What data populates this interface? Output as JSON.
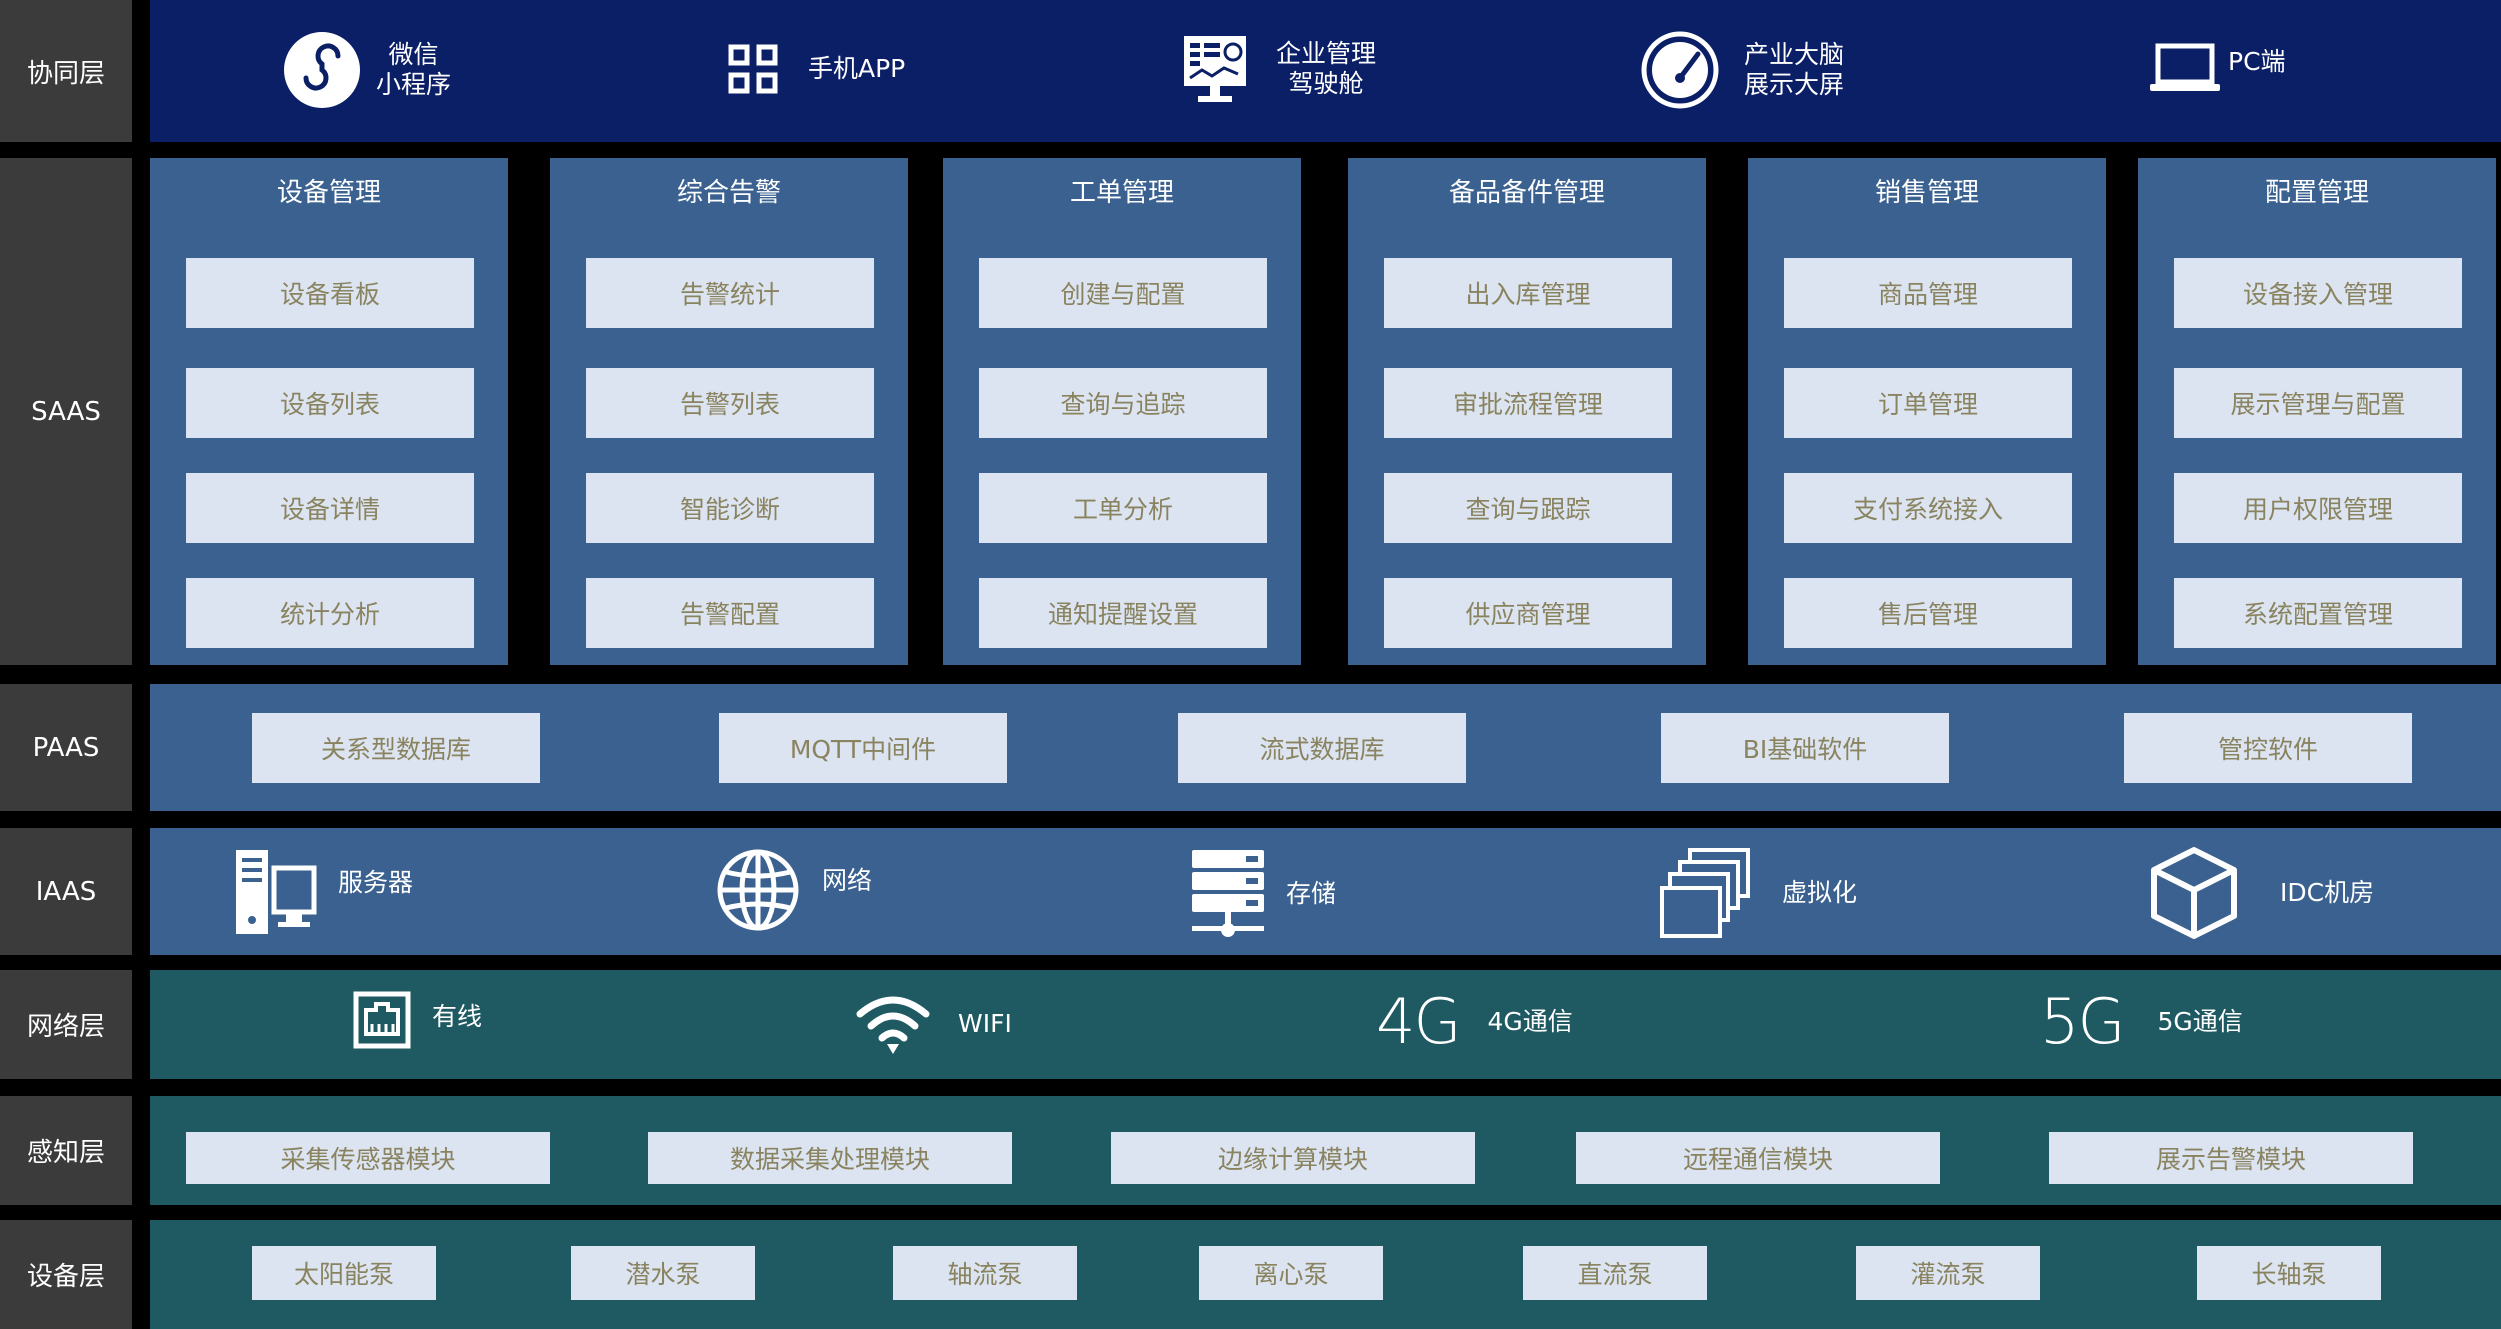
{
  "rows": {
    "collab": "协同层",
    "saas": "SAAS",
    "paas": "PAAS",
    "iaas": "IAAS",
    "network": "网络层",
    "perception": "感知层",
    "device": "设备层"
  },
  "collab_items": [
    {
      "line1": "微信",
      "line2": "小程序",
      "icon": "wechat-miniprogram-icon"
    },
    {
      "line1": "手机APP",
      "line2": "",
      "icon": "app-grid-icon"
    },
    {
      "line1": "企业管理",
      "line2": "驾驶舱",
      "icon": "dashboard-monitor-icon"
    },
    {
      "line1": "产业大脑",
      "line2": "展示大屏",
      "icon": "speedometer-icon"
    },
    {
      "line1": "PC端",
      "line2": "",
      "icon": "laptop-icon"
    }
  ],
  "saas_columns": [
    {
      "title": "设备管理",
      "modules": [
        "设备看板",
        "设备列表",
        "设备详情",
        "统计分析"
      ]
    },
    {
      "title": "综合告警",
      "modules": [
        "告警统计",
        "告警列表",
        "智能诊断",
        "告警配置"
      ]
    },
    {
      "title": "工单管理",
      "modules": [
        "创建与配置",
        "查询与追踪",
        "工单分析",
        "通知提醒设置"
      ]
    },
    {
      "title": "备品备件管理",
      "modules": [
        "出入库管理",
        "审批流程管理",
        "查询与跟踪",
        "供应商管理"
      ]
    },
    {
      "title": "销售管理",
      "modules": [
        "商品管理",
        "订单管理",
        "支付系统接入",
        "售后管理"
      ]
    },
    {
      "title": "配置管理",
      "modules": [
        "设备接入管理",
        "展示管理与配置",
        "用户权限管理",
        "系统配置管理"
      ]
    }
  ],
  "paas_items": [
    "关系型数据库",
    "MQTT中间件",
    "流式数据库",
    "BI基础软件",
    "管控软件"
  ],
  "iaas_items": [
    {
      "label": "服务器",
      "icon": "server-icon"
    },
    {
      "label": "网络",
      "icon": "globe-icon"
    },
    {
      "label": "存储",
      "icon": "storage-icon"
    },
    {
      "label": "虚拟化",
      "icon": "virtualization-icon"
    },
    {
      "label": "IDC机房",
      "icon": "cube-icon"
    }
  ],
  "network_items": [
    {
      "label": "有线",
      "icon": "ethernet-icon",
      "glyph": ""
    },
    {
      "label": "WIFI",
      "icon": "wifi-icon",
      "glyph": ""
    },
    {
      "label": "4G通信",
      "icon": "4g-icon",
      "glyph": "4G"
    },
    {
      "label": "5G通信",
      "icon": "5g-icon",
      "glyph": "5G"
    }
  ],
  "perception_items": [
    "采集传感器模块",
    "数据采集处理模块",
    "边缘计算模块",
    "远程通信模块",
    "展示告警模块"
  ],
  "device_items": [
    "太阳能泵",
    "潜水泵",
    "轴流泵",
    "离心泵",
    "直流泵",
    "灌流泵",
    "长轴泵"
  ],
  "colors": {
    "navy_band": "#0b1f66",
    "blue_band": "#3a6190",
    "teal_band": "#1f5a63",
    "label_bg": "#3b3b3b",
    "box_bg": "#dbe4f0",
    "box_text": "#8a8360"
  }
}
